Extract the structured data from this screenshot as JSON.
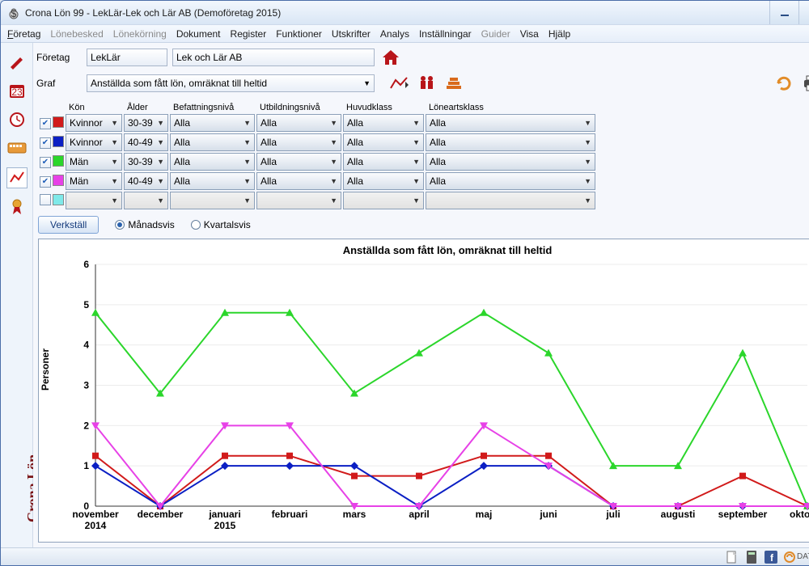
{
  "window_title": "Crona Lön 99 - LekLär-Lek och Lär AB (Demoföretag 2015)",
  "menu": {
    "foretag": "Företag",
    "lonebesked": "Lönebesked",
    "lonekorning": "Lönekörning",
    "dokument": "Dokument",
    "register": "Register",
    "funktioner": "Funktioner",
    "utskrifter": "Utskrifter",
    "analys": "Analys",
    "installningar": "Inställningar",
    "guider": "Guider",
    "visa": "Visa",
    "hjalp": "Hjälp"
  },
  "sidebar_logo": "Crona Lön",
  "header": {
    "company_label": "Företag",
    "company_code": "LekLär",
    "company_name": "Lek och Lär AB",
    "graph_label": "Graf",
    "graph_name": "Anställda som fått lön, omräknat till heltid"
  },
  "filters": {
    "headers": {
      "kon": "Kön",
      "alder": "Ålder",
      "befatt": "Befattningsnivå",
      "utbild": "Utbildningsnivå",
      "huvud": "Huvudklass",
      "loneart": "Löneartsklass"
    },
    "rows": [
      {
        "checked": true,
        "color": "#d11a1a",
        "kon": "Kvinnor",
        "alder": "30-39",
        "befatt": "Alla",
        "utbild": "Alla",
        "huvud": "Alla",
        "loneart": "Alla"
      },
      {
        "checked": true,
        "color": "#0b1fc4",
        "kon": "Kvinnor",
        "alder": "40-49",
        "befatt": "Alla",
        "utbild": "Alla",
        "huvud": "Alla",
        "loneart": "Alla"
      },
      {
        "checked": true,
        "color": "#2bd62b",
        "kon": "Män",
        "alder": "30-39",
        "befatt": "Alla",
        "utbild": "Alla",
        "huvud": "Alla",
        "loneart": "Alla"
      },
      {
        "checked": true,
        "color": "#e741e7",
        "kon": "Män",
        "alder": "40-49",
        "befatt": "Alla",
        "utbild": "Alla",
        "huvud": "Alla",
        "loneart": "Alla"
      },
      {
        "checked": false,
        "color": "#7fe9e9",
        "kon": "",
        "alder": "",
        "befatt": "",
        "utbild": "",
        "huvud": "",
        "loneart": ""
      }
    ],
    "apply": "Verkställ",
    "period_monthly": "Månadsvis",
    "period_quarterly": "Kvartalsvis",
    "period_selected": "monthly"
  },
  "statusbar_datavara": "DATAVARA AB",
  "chart_data": {
    "type": "line",
    "title": "Anställda som fått lön, omräknat till heltid",
    "ylabel": "Personer",
    "xlabel": "",
    "ylim": [
      0,
      6
    ],
    "categories": [
      "november",
      "december",
      "januari",
      "februari",
      "mars",
      "april",
      "maj",
      "juni",
      "juli",
      "augusti",
      "september",
      "oktober"
    ],
    "category_year": [
      "2014",
      "",
      "2015",
      "",
      "",
      "",
      "",
      "",
      "",
      "",
      "",
      ""
    ],
    "series": [
      {
        "name": "Kvinnor 30-39",
        "color": "#d11a1a",
        "marker": "square",
        "values": [
          1.25,
          0,
          1.25,
          1.25,
          0.75,
          0.75,
          1.25,
          1.25,
          0,
          0,
          0.75,
          0
        ]
      },
      {
        "name": "Kvinnor 40-49",
        "color": "#0b1fc4",
        "marker": "diamond",
        "values": [
          1,
          0,
          1,
          1,
          1,
          0,
          1,
          1,
          0,
          0,
          0,
          0
        ]
      },
      {
        "name": "Män 30-39",
        "color": "#2bd62b",
        "marker": "triangle",
        "values": [
          4.8,
          2.8,
          4.8,
          4.8,
          2.8,
          3.8,
          4.8,
          3.8,
          1,
          1,
          3.8,
          0
        ]
      },
      {
        "name": "Män 40-49",
        "color": "#e741e7",
        "marker": "triangle-down",
        "values": [
          2,
          0,
          2,
          2,
          0,
          0,
          2,
          1,
          0,
          0,
          0,
          0
        ]
      }
    ]
  }
}
